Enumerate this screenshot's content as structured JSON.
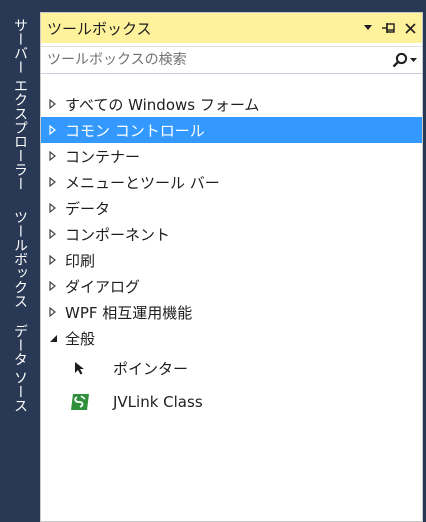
{
  "side_tabs": {
    "server_explorer": "サーバー エクスプローラー",
    "toolbox": "ツールボックス",
    "data_sources": "データ ソース"
  },
  "window": {
    "title": "ツールボックス",
    "dropdown_icon": "triangle-down",
    "pin_icon": "pin",
    "close_icon": "close-x"
  },
  "search": {
    "placeholder": "ツールボックスの検索",
    "icon": "magnifier"
  },
  "categories": [
    {
      "label": "すべての Windows フォーム",
      "expanded": false,
      "selected": false
    },
    {
      "label": "コモン コントロール",
      "expanded": false,
      "selected": true
    },
    {
      "label": "コンテナー",
      "expanded": false,
      "selected": false
    },
    {
      "label": "メニューとツール バー",
      "expanded": false,
      "selected": false
    },
    {
      "label": "データ",
      "expanded": false,
      "selected": false
    },
    {
      "label": "コンポーネント",
      "expanded": false,
      "selected": false
    },
    {
      "label": "印刷",
      "expanded": false,
      "selected": false
    },
    {
      "label": "ダイアログ",
      "expanded": false,
      "selected": false
    },
    {
      "label": "WPF 相互運用機能",
      "expanded": false,
      "selected": false
    },
    {
      "label": "全般",
      "expanded": true,
      "selected": false
    }
  ],
  "general_items": [
    {
      "label": "ポインター",
      "icon": "pointer-arrow"
    },
    {
      "label": "JVLink Class",
      "icon": "jvlink-component"
    }
  ],
  "colors": {
    "title_bar": "#fff29d",
    "selection": "#3399ff",
    "side_strip": "#293955"
  }
}
